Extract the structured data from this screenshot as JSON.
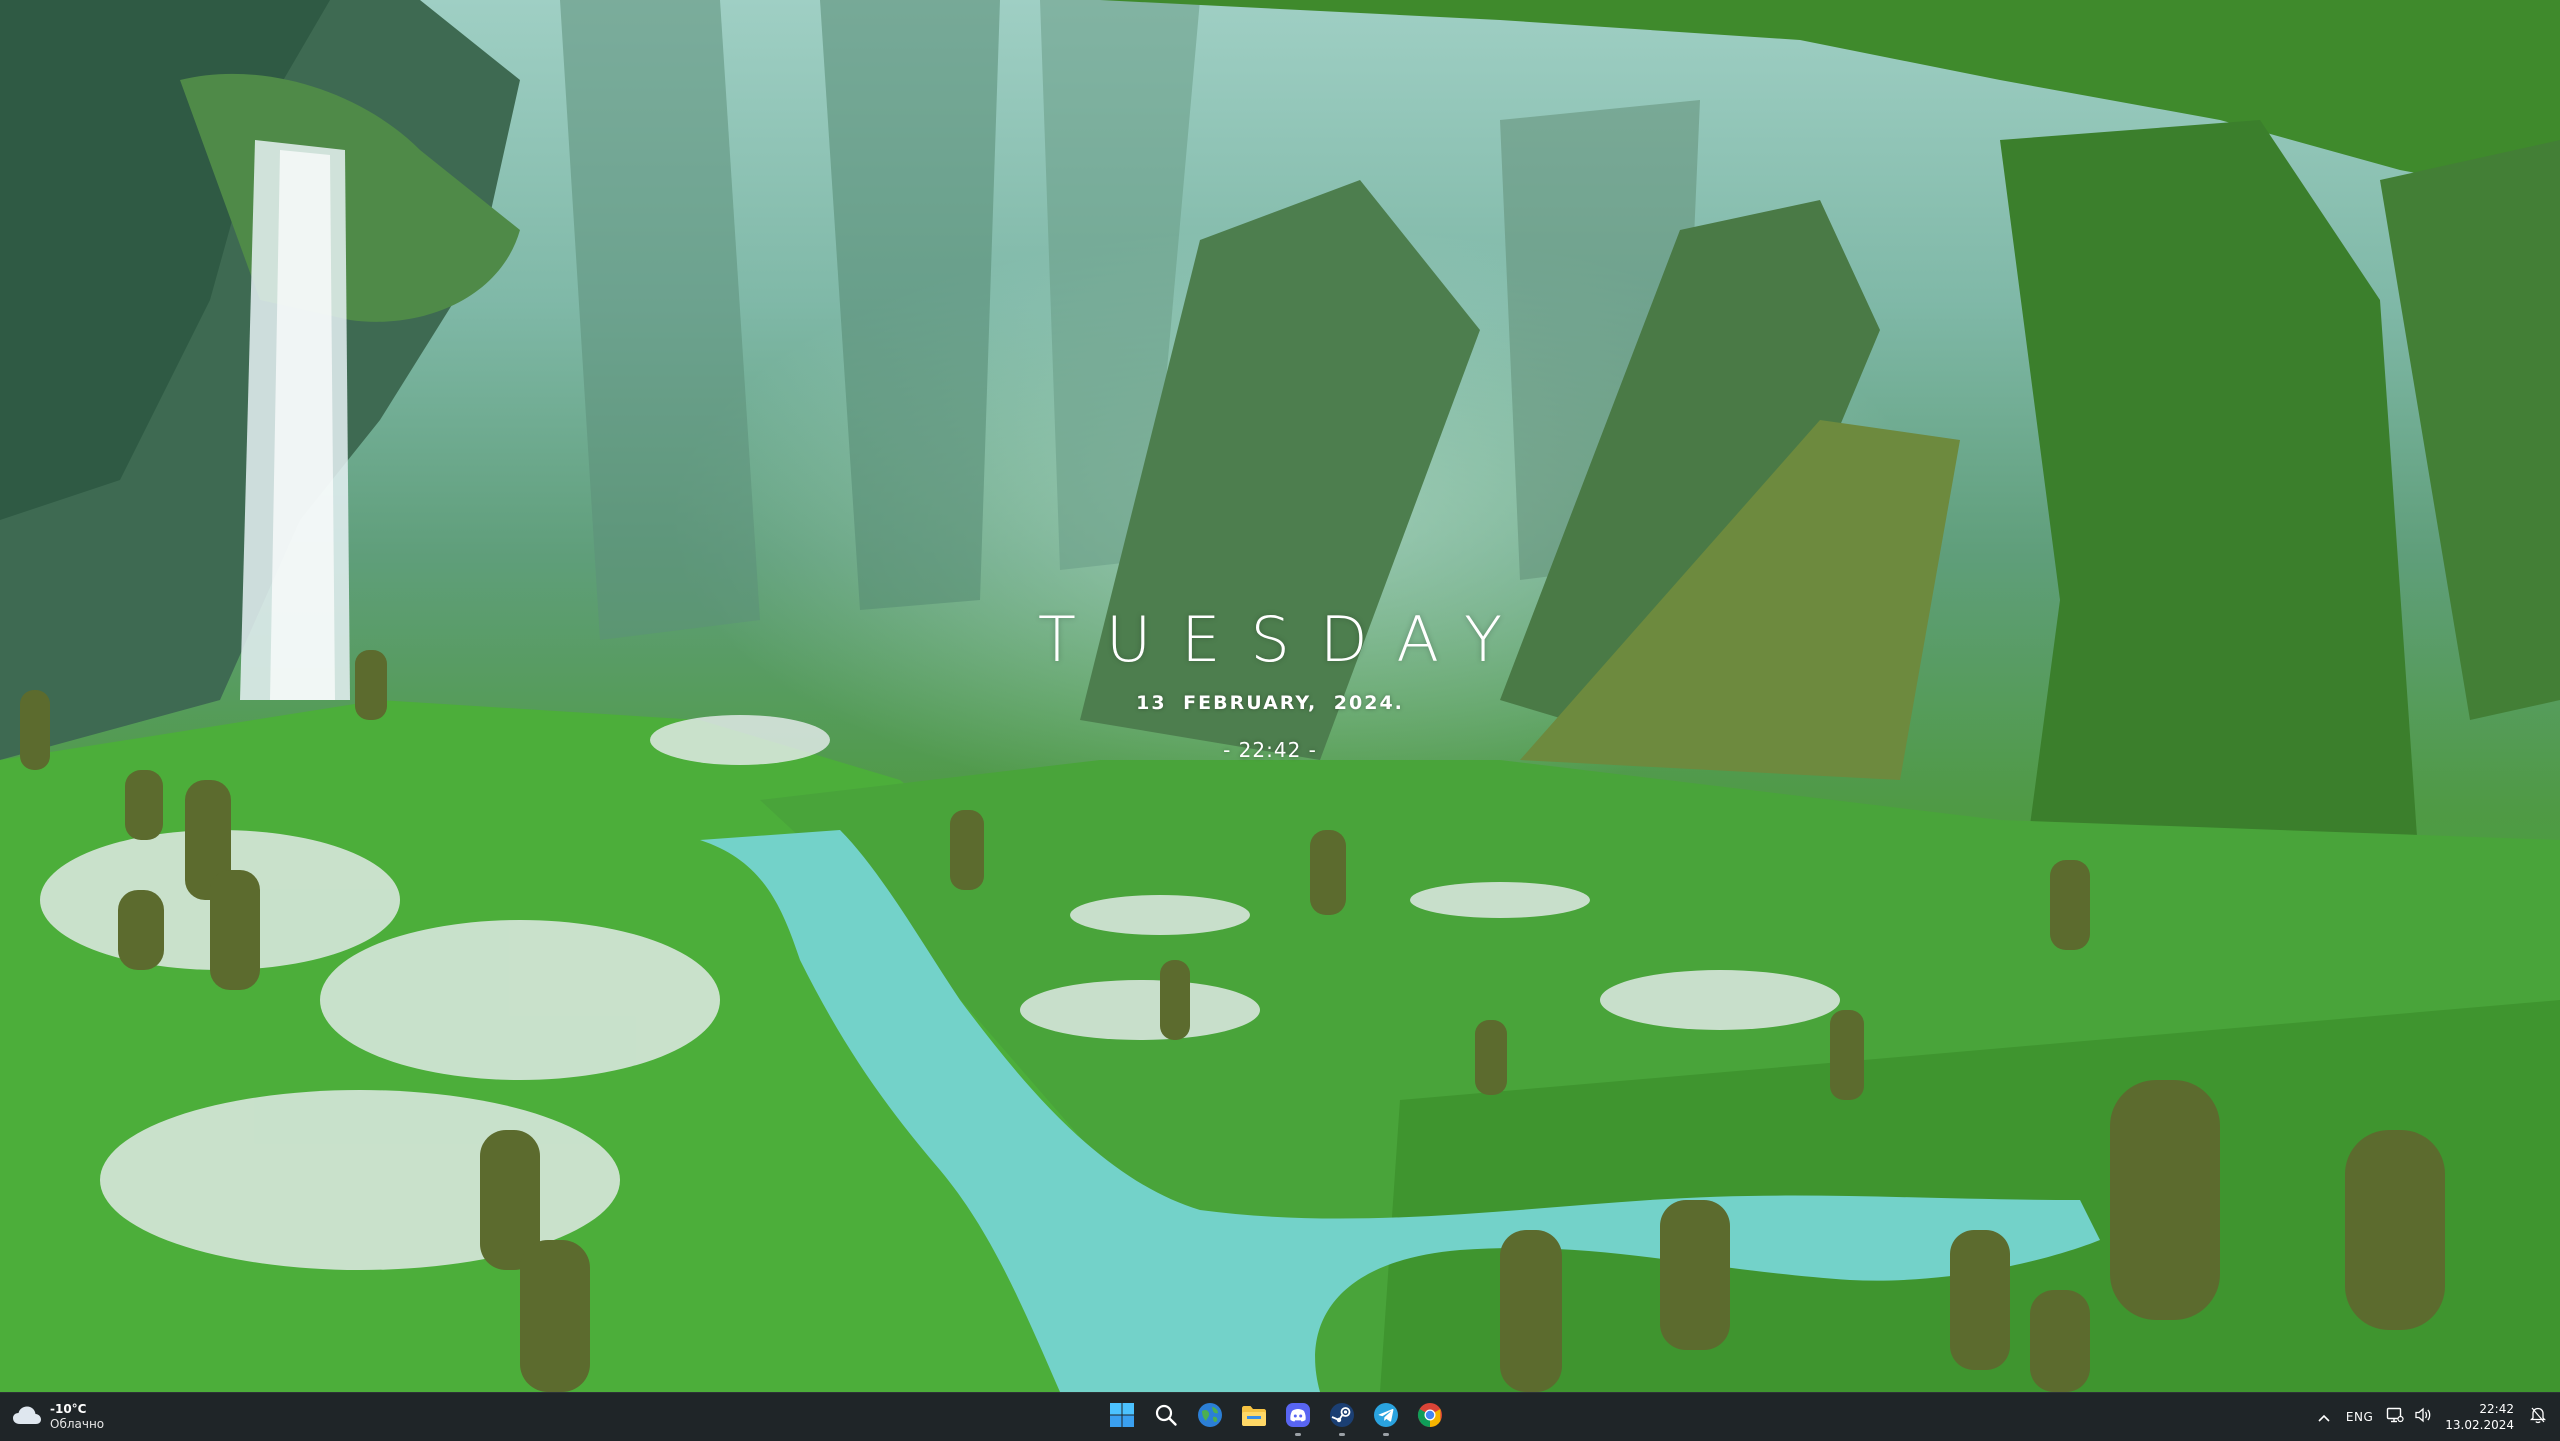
{
  "widget": {
    "day": "TUESDAY",
    "date": "13 FEBRUARY, 2024.",
    "time": "- 22:42 -"
  },
  "taskbar": {
    "weather": {
      "temperature": "-10°C",
      "condition": "Облачно",
      "icon": "cloud-icon"
    },
    "apps": [
      {
        "name": "start",
        "icon": "windows-logo-icon",
        "running": false
      },
      {
        "name": "search",
        "icon": "search-icon",
        "running": false
      },
      {
        "name": "browser",
        "icon": "globe-icon",
        "running": false
      },
      {
        "name": "file-explorer",
        "icon": "folder-icon",
        "running": false
      },
      {
        "name": "discord",
        "icon": "discord-icon",
        "running": true
      },
      {
        "name": "steam",
        "icon": "steam-icon",
        "running": true
      },
      {
        "name": "telegram",
        "icon": "telegram-icon",
        "running": true
      },
      {
        "name": "chrome",
        "icon": "chrome-icon",
        "running": false
      }
    ],
    "tray": {
      "overflow_icon": "chevron-up-icon",
      "language": "ENG",
      "clock_time": "22:42",
      "clock_date": "13.02.2024"
    }
  },
  "colors": {
    "taskbar_bg": "#1f2528",
    "widget_text": "#ffffff",
    "water": "#6fd0c8",
    "grass": "#4aa23a"
  }
}
